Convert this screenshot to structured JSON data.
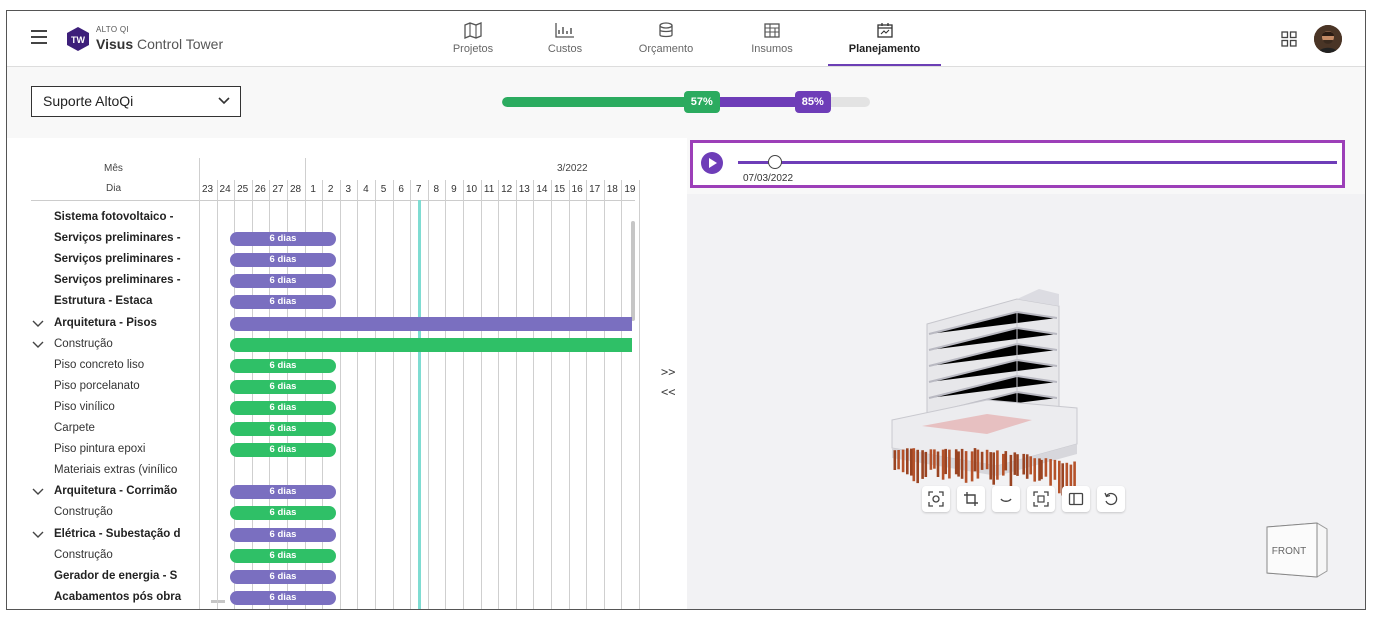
{
  "header": {
    "brand_small": "ALTO QI",
    "brand_bold": "Visus",
    "brand_rest": " Control Tower",
    "logo_text": "TW",
    "nav": [
      {
        "label": "Projetos",
        "icon": "map-icon"
      },
      {
        "label": "Custos",
        "icon": "chart-icon"
      },
      {
        "label": "Orçamento",
        "icon": "database-icon"
      },
      {
        "label": "Insumos",
        "icon": "spreadsheet-icon"
      },
      {
        "label": "Planejamento",
        "icon": "calendar-icon",
        "active": true
      }
    ]
  },
  "filter": {
    "selected": "Suporte AltoQi"
  },
  "progress": {
    "green_percent": 57,
    "purple_percent": 85,
    "green_label": "57%",
    "purple_label": "85%",
    "colors": {
      "green": "#2bab5f",
      "purple": "#6e3db8"
    }
  },
  "gantt": {
    "label_month": "Mês",
    "label_day": "Dia",
    "month": "3/2022",
    "days": [
      "23",
      "24",
      "25",
      "26",
      "27",
      "28",
      "1",
      "2",
      "3",
      "4",
      "5",
      "6",
      "7",
      "8",
      "9",
      "10",
      "11",
      "12",
      "13",
      "14",
      "15",
      "16",
      "17",
      "18",
      "19"
    ],
    "tasks": [
      {
        "name": "Sistema fotovoltaico -",
        "bold": true
      },
      {
        "name": "Serviços preliminares -",
        "bold": true,
        "bar": "6 dias",
        "color": "purple"
      },
      {
        "name": "Serviços preliminares -",
        "bold": true,
        "bar": "6 dias",
        "color": "purple"
      },
      {
        "name": "Serviços preliminares -",
        "bold": true,
        "bar": "6 dias",
        "color": "purple"
      },
      {
        "name": "Estrutura - Estaca",
        "bold": true,
        "bar": "6 dias",
        "color": "purple"
      },
      {
        "name": "Arquitetura - Pisos",
        "bold": true,
        "chev": true,
        "long": "purple"
      },
      {
        "name": "Construção",
        "chev": true,
        "long": "green"
      },
      {
        "name": "Piso concreto liso",
        "bar": "6 dias",
        "color": "green"
      },
      {
        "name": "Piso porcelanato",
        "bar": "6 dias",
        "color": "green"
      },
      {
        "name": "Piso vinílico",
        "bar": "6 dias",
        "color": "green"
      },
      {
        "name": "Carpete",
        "bar": "6 dias",
        "color": "green"
      },
      {
        "name": "Piso pintura epoxi",
        "bar": "6 dias",
        "color": "green"
      },
      {
        "name": "Materiais extras (vinílico"
      },
      {
        "name": "Arquitetura - Corrimão",
        "bold": true,
        "chev": true,
        "bar": "6 dias",
        "color": "purple"
      },
      {
        "name": "Construção",
        "bar": "6 dias",
        "color": "green"
      },
      {
        "name": "Elétrica - Subestação d",
        "bold": true,
        "chev": true,
        "bar": "6 dias",
        "color": "purple"
      },
      {
        "name": "Construção",
        "bar": "6 dias",
        "color": "green"
      },
      {
        "name": "Gerador de energia - S",
        "bold": true,
        "bar": "6 dias",
        "color": "purple"
      },
      {
        "name": "Acabamentos pós obra",
        "bold": true,
        "bar": "6 dias",
        "color": "purple"
      }
    ]
  },
  "collapse": {
    "expand": ">>",
    "collapse": "<<"
  },
  "timeline": {
    "date": "07/03/2022",
    "position": 0.06
  },
  "viewer": {
    "cube_label": "FRONT",
    "tools": [
      "focus-icon",
      "crop-icon",
      "orbit-icon",
      "fit-icon",
      "panel-icon",
      "reset-icon"
    ]
  }
}
